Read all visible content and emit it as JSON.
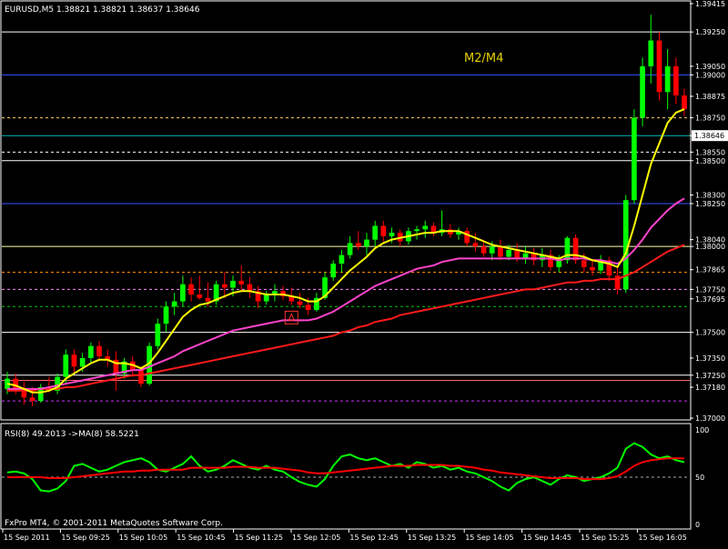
{
  "header": {
    "symbol_line": "EURUSD,M5  1.38821 1.38821 1.38637 1.38646",
    "center_label": "M2/M4"
  },
  "indicator": {
    "label": "RSI(8) 49.2013  ->MA(8) 58.5221",
    "axis_labels": [
      "100",
      "50",
      "0"
    ]
  },
  "footer": {
    "copyright": "FxPro MT4, © 2001-2011 MetaQuotes Software Corp."
  },
  "colors": {
    "background": "#000000",
    "bull": "#00ff00",
    "bear": "#ff0000",
    "ma_fast": "#ffff00",
    "ma_mid": "#ff44cc",
    "ma_slow": "#ff1a1a",
    "rsi": "#00ff00",
    "rsi_ma": "#ff0000",
    "grid": "#ffffff",
    "label_yellow": "#e6d200"
  },
  "chart_data": [
    {
      "type": "candlestick",
      "title": "EURUSD,M5",
      "ylim": [
        1.37,
        1.39415
      ],
      "price_axis_labels": [
        "1.39415",
        "1.39250",
        "1.39050",
        "1.39000",
        "1.38875",
        "1.38750",
        "1.38646",
        "1.38550",
        "1.38500",
        "1.38300",
        "1.38250",
        "1.38040",
        "1.38000",
        "1.37865",
        "1.37750",
        "1.37695",
        "1.37500",
        "1.37350",
        "1.37250",
        "1.37180",
        "1.37000"
      ],
      "time_labels": [
        "15 Sep 2011",
        "15 Sep 09:25",
        "15 Sep 10:05",
        "15 Sep 10:45",
        "15 Sep 11:25",
        "15 Sep 12:05",
        "15 Sep 12:45",
        "15 Sep 13:25",
        "15 Sep 14:05",
        "15 Sep 14:45",
        "15 Sep 15:25",
        "15 Sep 16:05"
      ],
      "current_price": 1.38646,
      "levels": [
        {
          "price": 1.3925,
          "color": "#ffffff",
          "style": "solid"
        },
        {
          "price": 1.39,
          "color": "#3355ff",
          "style": "solid"
        },
        {
          "price": 1.3875,
          "color": "#ffcc66",
          "style": "dashed"
        },
        {
          "price": 1.38646,
          "color": "#00bbbb",
          "style": "solid"
        },
        {
          "price": 1.3855,
          "color": "#ffffff",
          "style": "dashed"
        },
        {
          "price": 1.385,
          "color": "#ffffff",
          "style": "solid"
        },
        {
          "price": 1.3825,
          "color": "#3355ff",
          "style": "solid"
        },
        {
          "price": 1.38,
          "color": "#ffffaa",
          "style": "solid"
        },
        {
          "price": 1.3785,
          "color": "#ff8800",
          "style": "dashed"
        },
        {
          "price": 1.3775,
          "color": "#ff88ff",
          "style": "dashed"
        },
        {
          "price": 1.3765,
          "color": "#00cc00",
          "style": "dashed"
        },
        {
          "price": 1.375,
          "color": "#ffffff",
          "style": "solid"
        },
        {
          "price": 1.3725,
          "color": "#ffffff",
          "style": "solid"
        },
        {
          "price": 1.3722,
          "color": "#ff6666",
          "style": "solid"
        },
        {
          "price": 1.371,
          "color": "#cc33ff",
          "style": "dashed"
        }
      ],
      "candles_ohlc": [
        [
          1.3717,
          1.3727,
          1.3714,
          1.3723
        ],
        [
          1.3723,
          1.3726,
          1.3714,
          1.3717
        ],
        [
          1.3717,
          1.3721,
          1.3708,
          1.3712
        ],
        [
          1.3712,
          1.3718,
          1.3707,
          1.371
        ],
        [
          1.371,
          1.372,
          1.3709,
          1.3718
        ],
        [
          1.3718,
          1.3724,
          1.3715,
          1.3716
        ],
        [
          1.3716,
          1.3726,
          1.3714,
          1.3724
        ],
        [
          1.3724,
          1.374,
          1.372,
          1.3737
        ],
        [
          1.3737,
          1.374,
          1.3726,
          1.373
        ],
        [
          1.373,
          1.3738,
          1.3727,
          1.3735
        ],
        [
          1.3735,
          1.3744,
          1.3732,
          1.3742
        ],
        [
          1.3742,
          1.3745,
          1.3734,
          1.3736
        ],
        [
          1.3736,
          1.374,
          1.373,
          1.3734
        ],
        [
          1.3734,
          1.3739,
          1.3716,
          1.3726
        ],
        [
          1.3726,
          1.3735,
          1.3723,
          1.3733
        ],
        [
          1.3733,
          1.3736,
          1.3724,
          1.3728
        ],
        [
          1.3728,
          1.373,
          1.3718,
          1.372
        ],
        [
          1.372,
          1.3744,
          1.3719,
          1.3742
        ],
        [
          1.3742,
          1.3758,
          1.374,
          1.3755
        ],
        [
          1.3755,
          1.3768,
          1.375,
          1.3765
        ],
        [
          1.3765,
          1.3773,
          1.376,
          1.3768
        ],
        [
          1.3768,
          1.3783,
          1.3765,
          1.3778
        ],
        [
          1.3778,
          1.3782,
          1.3768,
          1.3772
        ],
        [
          1.3772,
          1.3783,
          1.3769,
          1.377
        ],
        [
          1.377,
          1.3779,
          1.3765,
          1.3768
        ],
        [
          1.3768,
          1.378,
          1.3766,
          1.3778
        ],
        [
          1.3778,
          1.3785,
          1.377,
          1.3776
        ],
        [
          1.3776,
          1.3783,
          1.3771,
          1.378
        ],
        [
          1.378,
          1.3789,
          1.3774,
          1.3778
        ],
        [
          1.3778,
          1.3782,
          1.377,
          1.3774
        ],
        [
          1.3774,
          1.3777,
          1.3764,
          1.3768
        ],
        [
          1.3768,
          1.3774,
          1.3766,
          1.3772
        ],
        [
          1.3772,
          1.3778,
          1.3768,
          1.3774
        ],
        [
          1.3774,
          1.3777,
          1.3769,
          1.3771
        ],
        [
          1.3771,
          1.3776,
          1.3766,
          1.3768
        ],
        [
          1.3768,
          1.3773,
          1.3764,
          1.3766
        ],
        [
          1.3766,
          1.377,
          1.376,
          1.3763
        ],
        [
          1.3763,
          1.3773,
          1.3762,
          1.377
        ],
        [
          1.377,
          1.3785,
          1.3769,
          1.3782
        ],
        [
          1.3782,
          1.3792,
          1.378,
          1.379
        ],
        [
          1.379,
          1.3798,
          1.3785,
          1.3795
        ],
        [
          1.3795,
          1.3806,
          1.3793,
          1.3802
        ],
        [
          1.3802,
          1.3809,
          1.3798,
          1.38
        ],
        [
          1.38,
          1.3808,
          1.3795,
          1.3804
        ],
        [
          1.3804,
          1.3815,
          1.38,
          1.3812
        ],
        [
          1.3812,
          1.3815,
          1.3803,
          1.3806
        ],
        [
          1.3806,
          1.3811,
          1.3802,
          1.3808
        ],
        [
          1.3808,
          1.381,
          1.38,
          1.3803
        ],
        [
          1.3803,
          1.3811,
          1.3801,
          1.3809
        ],
        [
          1.3809,
          1.3812,
          1.3804,
          1.381
        ],
        [
          1.381,
          1.3815,
          1.3805,
          1.3812
        ],
        [
          1.3812,
          1.3814,
          1.3806,
          1.3808
        ],
        [
          1.3808,
          1.3821,
          1.3806,
          1.381
        ],
        [
          1.381,
          1.3813,
          1.3805,
          1.3807
        ],
        [
          1.3807,
          1.3811,
          1.3804,
          1.3809
        ],
        [
          1.3809,
          1.3811,
          1.38,
          1.3802
        ],
        [
          1.3802,
          1.3808,
          1.3797,
          1.38
        ],
        [
          1.38,
          1.3804,
          1.3794,
          1.3796
        ],
        [
          1.3796,
          1.3803,
          1.3792,
          1.38
        ],
        [
          1.38,
          1.3804,
          1.3792,
          1.3794
        ],
        [
          1.3794,
          1.3801,
          1.3792,
          1.3798
        ],
        [
          1.3798,
          1.3802,
          1.3791,
          1.3793
        ],
        [
          1.3793,
          1.38,
          1.379,
          1.3796
        ],
        [
          1.3796,
          1.3799,
          1.3789,
          1.3792
        ],
        [
          1.3792,
          1.3799,
          1.3788,
          1.3795
        ],
        [
          1.3795,
          1.3798,
          1.3786,
          1.3788
        ],
        [
          1.3788,
          1.3795,
          1.3785,
          1.3792
        ],
        [
          1.3792,
          1.3806,
          1.379,
          1.3805
        ],
        [
          1.3805,
          1.3807,
          1.379,
          1.3792
        ],
        [
          1.3792,
          1.3796,
          1.3785,
          1.3788
        ],
        [
          1.3788,
          1.3792,
          1.3783,
          1.3786
        ],
        [
          1.3786,
          1.3795,
          1.3784,
          1.3792
        ],
        [
          1.3792,
          1.3794,
          1.378,
          1.3783
        ],
        [
          1.3783,
          1.3788,
          1.3772,
          1.3775
        ],
        [
          1.3775,
          1.383,
          1.3773,
          1.3827
        ],
        [
          1.3827,
          1.388,
          1.3825,
          1.3875
        ],
        [
          1.3875,
          1.391,
          1.387,
          1.3905
        ],
        [
          1.3905,
          1.3935,
          1.3895,
          1.392
        ],
        [
          1.392,
          1.3925,
          1.3885,
          1.389
        ],
        [
          1.389,
          1.3915,
          1.388,
          1.3905
        ],
        [
          1.3905,
          1.391,
          1.3883,
          1.3888
        ],
        [
          1.3888,
          1.3892,
          1.3876,
          1.388
        ]
      ],
      "ma_fast": [
        1.372,
        1.3719,
        1.3717,
        1.3715,
        1.3715,
        1.3716,
        1.3718,
        1.3723,
        1.3726,
        1.3729,
        1.3732,
        1.3734,
        1.3734,
        1.3732,
        1.3732,
        1.3731,
        1.3729,
        1.3732,
        1.3738,
        1.3745,
        1.3752,
        1.3759,
        1.3763,
        1.3766,
        1.3767,
        1.3769,
        1.3771,
        1.3773,
        1.3774,
        1.3774,
        1.3773,
        1.3772,
        1.3772,
        1.3772,
        1.3771,
        1.377,
        1.3768,
        1.3768,
        1.3771,
        1.3776,
        1.3781,
        1.3786,
        1.379,
        1.3794,
        1.3799,
        1.3802,
        1.3804,
        1.3805,
        1.3806,
        1.3807,
        1.3808,
        1.3808,
        1.3809,
        1.3809,
        1.3809,
        1.3807,
        1.3805,
        1.3803,
        1.3801,
        1.38,
        1.3799,
        1.3798,
        1.3797,
        1.3796,
        1.3795,
        1.3794,
        1.3793,
        1.3795,
        1.3795,
        1.3794,
        1.3792,
        1.3791,
        1.379,
        1.3788,
        1.3796,
        1.3812,
        1.383,
        1.3848,
        1.386,
        1.3872,
        1.3878,
        1.388
      ],
      "ma_mid": [
        1.3717,
        1.3717,
        1.3717,
        1.3717,
        1.3717,
        1.3718,
        1.3719,
        1.372,
        1.3721,
        1.3722,
        1.3723,
        1.3724,
        1.3725,
        1.3726,
        1.3727,
        1.3728,
        1.3728,
        1.373,
        1.3732,
        1.3734,
        1.3736,
        1.3739,
        1.3741,
        1.3743,
        1.3745,
        1.3747,
        1.3749,
        1.3751,
        1.3752,
        1.3753,
        1.3754,
        1.3755,
        1.3756,
        1.3757,
        1.3757,
        1.3757,
        1.3757,
        1.3758,
        1.376,
        1.3762,
        1.3765,
        1.3768,
        1.3771,
        1.3774,
        1.3777,
        1.3779,
        1.3781,
        1.3783,
        1.3785,
        1.3787,
        1.3788,
        1.3789,
        1.3791,
        1.3792,
        1.3793,
        1.3793,
        1.3793,
        1.3793,
        1.3793,
        1.3793,
        1.3793,
        1.3793,
        1.3793,
        1.3793,
        1.3793,
        1.3793,
        1.3792,
        1.3793,
        1.3793,
        1.3793,
        1.3792,
        1.3792,
        1.3791,
        1.379,
        1.3793,
        1.3798,
        1.3804,
        1.3811,
        1.3816,
        1.3821,
        1.3825,
        1.3828
      ],
      "ma_slow": [
        1.3716,
        1.3716,
        1.3716,
        1.3716,
        1.3717,
        1.3717,
        1.3717,
        1.3718,
        1.3718,
        1.3719,
        1.372,
        1.3721,
        1.3722,
        1.3723,
        1.3724,
        1.3725,
        1.3725,
        1.3726,
        1.3727,
        1.3728,
        1.3729,
        1.373,
        1.3731,
        1.3732,
        1.3733,
        1.3734,
        1.3735,
        1.3736,
        1.3737,
        1.3738,
        1.3739,
        1.374,
        1.3741,
        1.3742,
        1.3743,
        1.3744,
        1.3745,
        1.3746,
        1.3747,
        1.3748,
        1.375,
        1.3751,
        1.3753,
        1.3754,
        1.3756,
        1.3757,
        1.3758,
        1.376,
        1.3761,
        1.3762,
        1.3763,
        1.3764,
        1.3765,
        1.3766,
        1.3767,
        1.3768,
        1.3769,
        1.377,
        1.3771,
        1.3772,
        1.3773,
        1.3774,
        1.3775,
        1.3775,
        1.3776,
        1.3777,
        1.3778,
        1.3779,
        1.3779,
        1.378,
        1.378,
        1.3781,
        1.3781,
        1.3781,
        1.3783,
        1.3785,
        1.3788,
        1.3791,
        1.3794,
        1.3797,
        1.3799,
        1.3801
      ],
      "marker_index": 34
    },
    {
      "type": "line",
      "title": "RSI(8) 49.2013  ->MA(8) 58.5221",
      "ylim": [
        0,
        100
      ],
      "reference_level": 50,
      "series": [
        {
          "name": "RSI(8)",
          "values": [
            55,
            56,
            54,
            48,
            36,
            35,
            38,
            46,
            62,
            64,
            60,
            56,
            58,
            62,
            66,
            68,
            70,
            66,
            58,
            56,
            60,
            64,
            72,
            62,
            56,
            58,
            62,
            68,
            64,
            60,
            58,
            62,
            58,
            56,
            50,
            45,
            42,
            40,
            48,
            62,
            72,
            74,
            70,
            68,
            70,
            66,
            62,
            64,
            60,
            66,
            64,
            60,
            62,
            58,
            60,
            56,
            54,
            50,
            46,
            40,
            36,
            44,
            48,
            50,
            46,
            42,
            48,
            52,
            50,
            46,
            48,
            50,
            54,
            60,
            80,
            86,
            82,
            74,
            70,
            72,
            68,
            66
          ]
        },
        {
          "name": "MA(8)",
          "values": [
            50,
            50,
            50,
            50,
            50,
            49,
            49,
            49,
            50,
            51,
            52,
            53,
            54,
            55,
            56,
            56,
            57,
            57,
            58,
            58,
            58,
            58,
            60,
            60,
            60,
            60,
            60,
            61,
            61,
            61,
            60,
            60,
            60,
            59,
            58,
            57,
            55,
            54,
            54,
            55,
            56,
            57,
            58,
            59,
            60,
            61,
            62,
            62,
            62,
            63,
            63,
            63,
            63,
            62,
            62,
            61,
            60,
            58,
            57,
            55,
            54,
            53,
            52,
            51,
            50,
            49,
            49,
            49,
            49,
            48,
            48,
            48,
            49,
            51,
            56,
            62,
            66,
            68,
            69,
            70,
            70,
            70
          ]
        }
      ]
    }
  ]
}
